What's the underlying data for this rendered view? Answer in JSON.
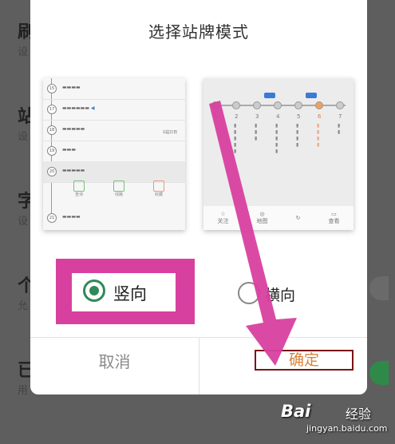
{
  "background": {
    "items": [
      {
        "title": "刷",
        "sub": "设"
      },
      {
        "title": "站",
        "sub": "设"
      },
      {
        "title": "字",
        "sub": "设"
      },
      {
        "title": "个",
        "sub": "允"
      },
      {
        "title": "已",
        "sub": "用"
      }
    ]
  },
  "dialog": {
    "title": "选择站牌模式",
    "preview_vertical": {
      "stops": [
        "15",
        "17",
        "18",
        "19",
        "20",
        "21"
      ],
      "transfer": "1站只日",
      "tabs": [
        "查询",
        "线路",
        "收藏"
      ]
    },
    "preview_horizontal": {
      "numbers": [
        "1",
        "2",
        "3",
        "4",
        "5",
        "6",
        "7"
      ],
      "tabs": [
        "关注",
        "地图",
        "",
        "查看"
      ]
    },
    "options": [
      {
        "label": "竖向",
        "selected": true
      },
      {
        "label": "横向",
        "selected": false
      }
    ],
    "cancel_label": "取消",
    "ok_label": "确定"
  },
  "watermark": {
    "brand": "Bai",
    "sub": "经验",
    "url": "jingyan.baidu.com"
  },
  "colors": {
    "accent": "#2f8a58",
    "highlight": "#d8409f",
    "confirm": "#d9833b"
  }
}
